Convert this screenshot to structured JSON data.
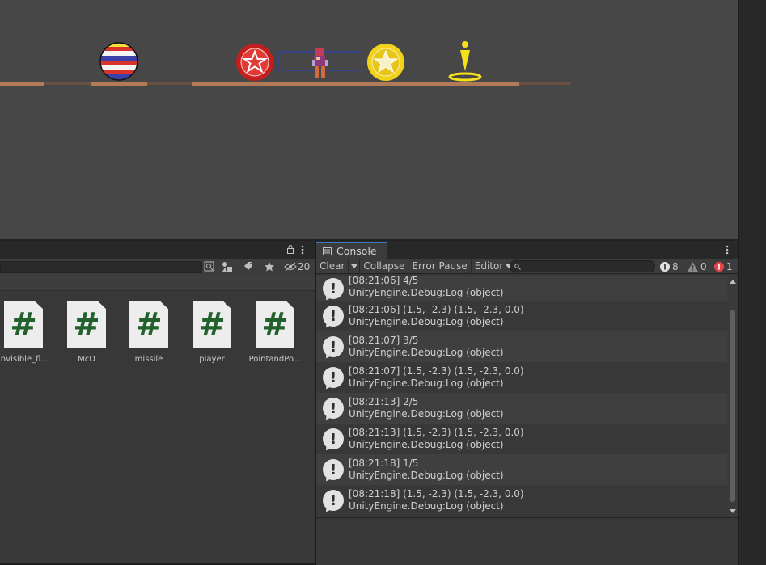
{
  "scene": {
    "sprites": [
      "striped-ball-icon",
      "red-star-coin-icon",
      "player-character-icon",
      "gold-star-coin-icon",
      "goal-marker-icon"
    ]
  },
  "project": {
    "hidden_count": "20",
    "assets": [
      {
        "label": "invisible_fl...",
        "glyph": "#"
      },
      {
        "label": "McD",
        "glyph": "#"
      },
      {
        "label": "missile",
        "glyph": "#"
      },
      {
        "label": "player",
        "glyph": "#"
      },
      {
        "label": "PointandPo...",
        "glyph": "#"
      }
    ]
  },
  "console": {
    "tab_label": "Console",
    "toolbar": {
      "clear": "Clear",
      "collapse": "Collapse",
      "error_pause": "Error Pause",
      "editor": "Editor"
    },
    "counts": {
      "info": "8",
      "warning": "0",
      "error": "1"
    },
    "logs": [
      {
        "line1": "[08:21:06] 4/5",
        "line2": "UnityEngine.Debug:Log (object)"
      },
      {
        "line1": "[08:21:06] (1.5, -2.3) (1.5, -2.3, 0.0)",
        "line2": "UnityEngine.Debug:Log (object)"
      },
      {
        "line1": "[08:21:07] 3/5",
        "line2": "UnityEngine.Debug:Log (object)"
      },
      {
        "line1": "[08:21:07] (1.5, -2.3) (1.5, -2.3, 0.0)",
        "line2": "UnityEngine.Debug:Log (object)"
      },
      {
        "line1": "[08:21:13] 2/5",
        "line2": "UnityEngine.Debug:Log (object)"
      },
      {
        "line1": "[08:21:13] (1.5, -2.3) (1.5, -2.3, 0.0)",
        "line2": "UnityEngine.Debug:Log (object)"
      },
      {
        "line1": "[08:21:18] 1/5",
        "line2": "UnityEngine.Debug:Log (object)"
      },
      {
        "line1": "[08:21:18] (1.5, -2.3) (1.5, -2.3, 0.0)",
        "line2": "UnityEngine.Debug:Log (object)"
      }
    ],
    "info_glyph": "!"
  }
}
